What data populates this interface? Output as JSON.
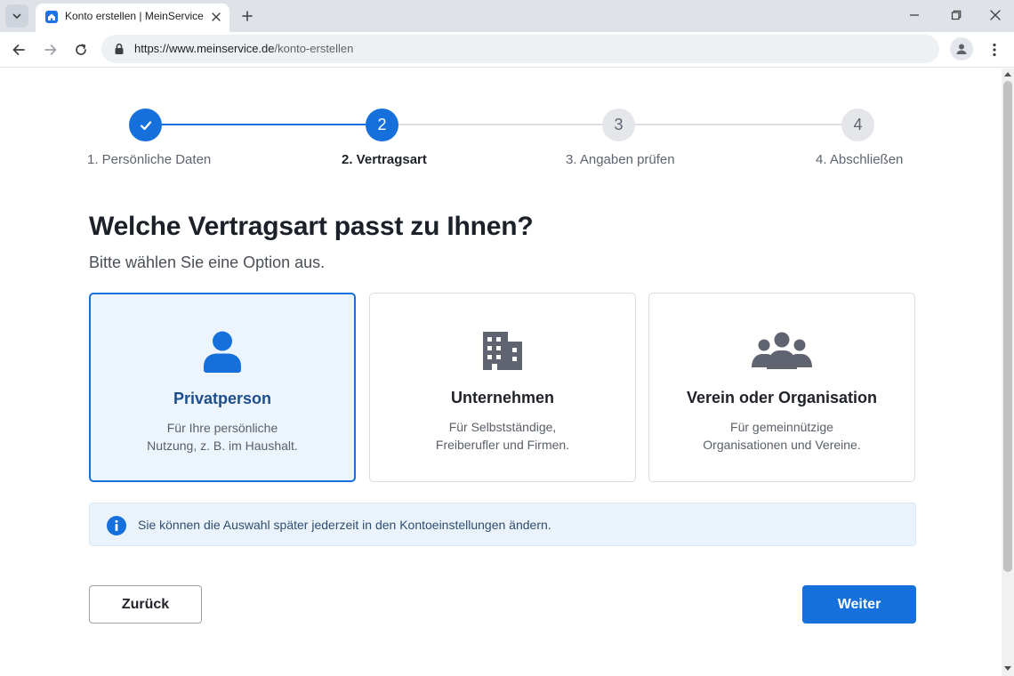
{
  "browser": {
    "tab_title": "Konto erstellen | MeinService",
    "url_host": "https://www.meinservice.de",
    "url_path": "/konto-erstellen"
  },
  "stepper": {
    "steps": [
      {
        "number": "1",
        "label": "1. Persönliche Daten",
        "state": "done"
      },
      {
        "number": "2",
        "label": "2. Vertragsart",
        "state": "active"
      },
      {
        "number": "3",
        "label": "3. Angaben prüfen",
        "state": "todo"
      },
      {
        "number": "4",
        "label": "4. Abschließen",
        "state": "todo"
      }
    ]
  },
  "main": {
    "title": "Welche Vertragsart passt zu Ihnen?",
    "subtitle": "Bitte wählen Sie eine Option aus.",
    "options": [
      {
        "icon": "person-icon",
        "title": "Privatperson",
        "desc_line1": "Für Ihre persönliche",
        "desc_line2": "Nutzung, z. B. im Haushalt.",
        "selected": true
      },
      {
        "icon": "building-icon",
        "title": "Unternehmen",
        "desc_line1": "Für Selbstständige,",
        "desc_line2": "Freiberufler und Firmen.",
        "selected": false
      },
      {
        "icon": "group-icon",
        "title": "Verein oder Organisation",
        "desc_line1": "Für gemeinnützige",
        "desc_line2": "Organisationen und Vereine.",
        "selected": false
      }
    ],
    "info_text": "Sie können die Auswahl später jederzeit in den Kontoeinstellungen ändern."
  },
  "actions": {
    "back_label": "Zurück",
    "next_label": "Weiter"
  },
  "colors": {
    "accent": "#1670dc",
    "selected_card_bg": "#ecf4fd",
    "info_bg": "#eaf3fc",
    "step_todo": "#e4e6ea",
    "icon_gray": "#5f6470"
  }
}
